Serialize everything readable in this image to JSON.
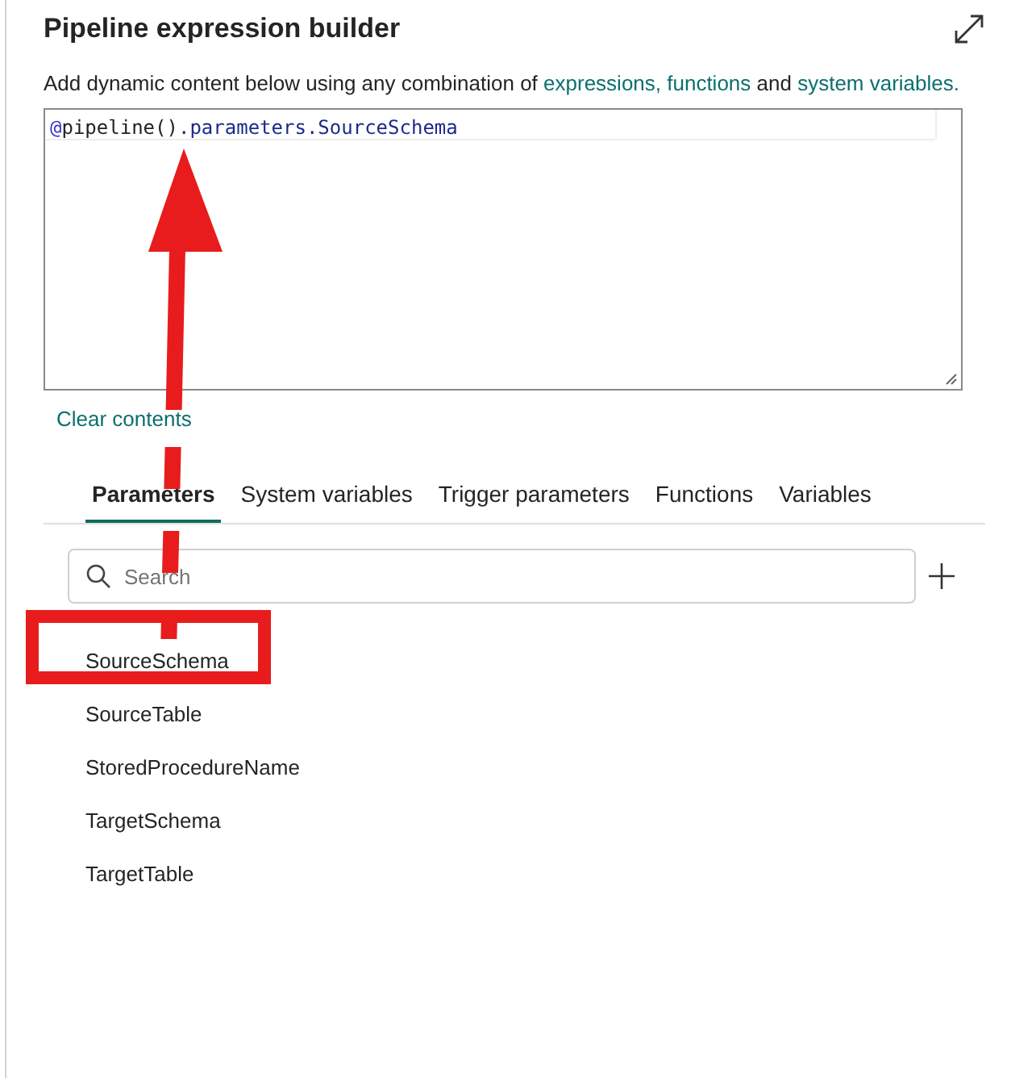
{
  "title": "Pipeline expression builder",
  "description": [
    {
      "kind": "text",
      "text": "Add dynamic content below using any combination of "
    },
    {
      "kind": "link",
      "text": "expressions, functions"
    },
    {
      "kind": "text",
      "text": " and "
    },
    {
      "kind": "link",
      "text": "system variables."
    }
  ],
  "expression": [
    {
      "kind": "at",
      "text": "@"
    },
    {
      "kind": "func",
      "text": "pipeline()"
    },
    {
      "kind": "prop",
      "text": ".parameters.SourceSchema"
    }
  ],
  "clear_link": "Clear contents",
  "tabs": [
    {
      "label": "Parameters",
      "selected": true
    },
    {
      "label": "System variables",
      "selected": false
    },
    {
      "label": "Trigger parameters",
      "selected": false
    },
    {
      "label": "Functions",
      "selected": false
    },
    {
      "label": "Variables",
      "selected": false
    }
  ],
  "search": {
    "placeholder": "Search"
  },
  "parameters": [
    {
      "name": "SourceSchema",
      "highlighted": true
    },
    {
      "name": "SourceTable",
      "highlighted": false
    },
    {
      "name": "StoredProcedureName",
      "highlighted": false
    },
    {
      "name": "TargetSchema",
      "highlighted": false
    },
    {
      "name": "TargetTable",
      "highlighted": false
    }
  ]
}
